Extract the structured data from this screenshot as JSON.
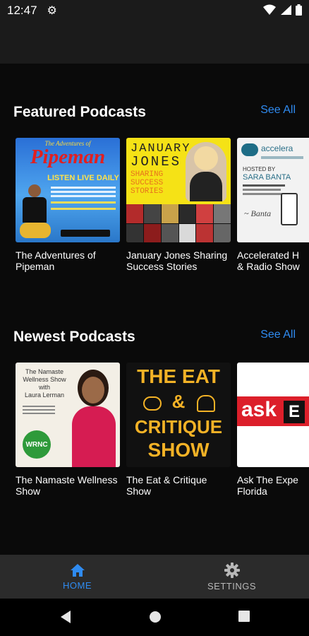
{
  "status": {
    "time": "12:47"
  },
  "featured": {
    "title": "Featured Podcasts",
    "see_all": "See All",
    "items": [
      {
        "title": "The Adventures of\nPipeman"
      },
      {
        "title": "January Jones Sharing\nSuccess Stories"
      },
      {
        "title": "Accelerated H\n& Radio Show"
      }
    ]
  },
  "newest": {
    "title": "Newest Podcasts",
    "see_all": "See All",
    "items": [
      {
        "title": "The Namaste Wellness\nShow"
      },
      {
        "title": "The Eat & Critique\nShow"
      },
      {
        "title": "Ask The Expe\nFlorida"
      }
    ]
  },
  "art": {
    "pipeman": {
      "top": "The Adventures of",
      "title": "Pipeman",
      "listen": "LISTEN LIVE DAILY"
    },
    "january": {
      "line1": "JANUARY",
      "line2": "JONES",
      "sub1": "SHARING",
      "sub2": "SUCCESS",
      "sub3": "STORIES"
    },
    "accelerated": {
      "brand": "accelera",
      "hosted": "HOSTED BY",
      "host": "SARA BANTA"
    },
    "namaste": {
      "line1": "The Namaste",
      "line2": "Wellness Show",
      "line3": "with",
      "line4": "Laura Lerman",
      "logo": "WRNC"
    },
    "eat": {
      "line1": "THE EAT",
      "line2": "&",
      "line3": "CRITIQUE",
      "line4": "SHOW"
    },
    "ask": {
      "word": "ask",
      "suffix": "E"
    }
  },
  "nav": {
    "home": "HOME",
    "settings": "SETTINGS"
  },
  "colors": {
    "accent": "#2f8bf0",
    "background": "#0a0a0a"
  }
}
